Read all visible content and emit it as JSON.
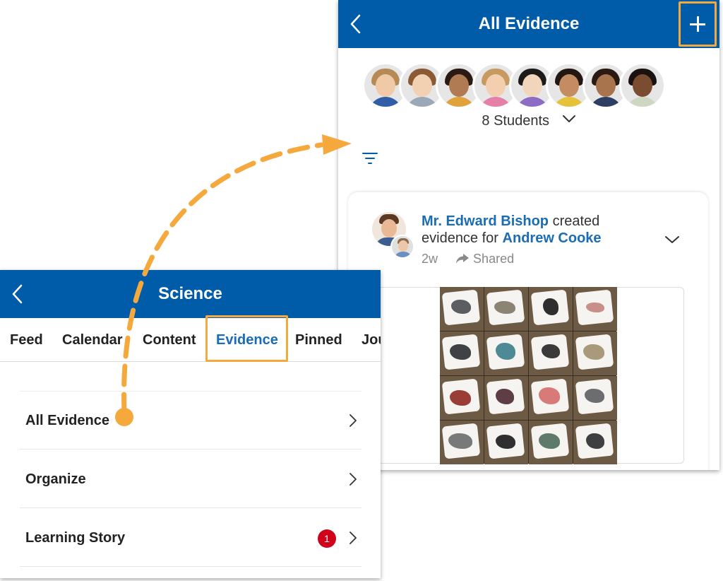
{
  "evidence_panel": {
    "title": "All Evidence",
    "students_label": "8 Students",
    "post": {
      "author": "Mr. Edward Bishop",
      "action_text": "created",
      "line2_text": "evidence for",
      "student": "Andrew Cooke",
      "age": "2w",
      "status": "Shared"
    }
  },
  "science_panel": {
    "title": "Science",
    "tabs": [
      {
        "label": "Feed"
      },
      {
        "label": "Calendar"
      },
      {
        "label": "Content"
      },
      {
        "label": "Evidence"
      },
      {
        "label": "Pinned"
      },
      {
        "label": "Jou"
      }
    ],
    "active_tab": "Evidence",
    "items": [
      {
        "label": "All Evidence"
      },
      {
        "label": "Organize"
      },
      {
        "label": "Learning Story",
        "badge": "1"
      }
    ]
  },
  "colors": {
    "brand_blue": "#005ca9",
    "link_blue": "#1a6db5",
    "highlight_orange": "#f5a93c",
    "badge_red": "#d0021b"
  },
  "icons": [
    "back-chevron-icon",
    "plus-icon",
    "chevron-down-icon",
    "filter-icon",
    "share-icon",
    "chevron-right-icon"
  ]
}
